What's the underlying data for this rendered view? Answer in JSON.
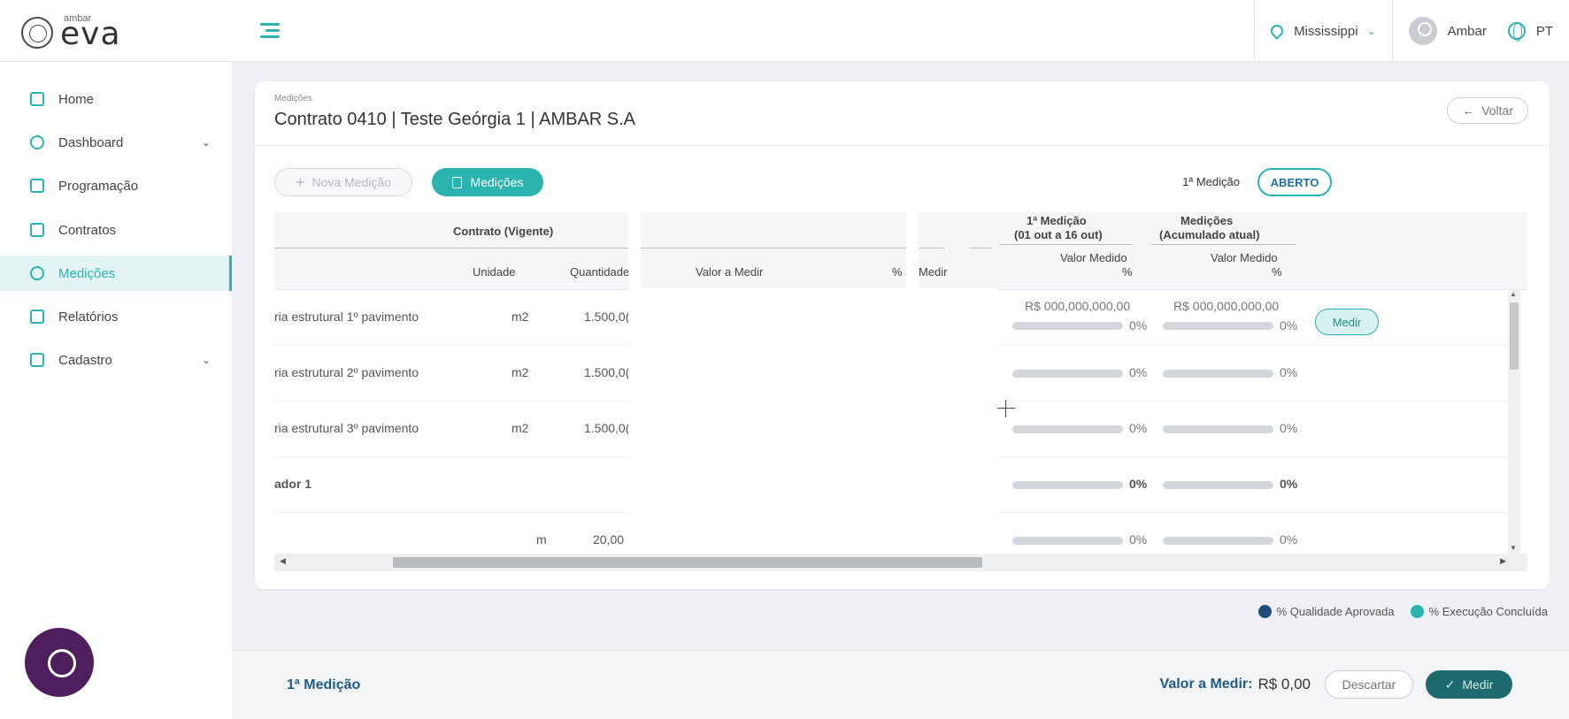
{
  "brand": {
    "small": "ambar",
    "big": "eva"
  },
  "topbar": {
    "location": "Mississippi",
    "user": "Ambar",
    "language": "PT"
  },
  "sidebar": {
    "items": [
      {
        "label": "Home",
        "icon": "home-icon"
      },
      {
        "label": "Dashboard",
        "icon": "dashboard-icon",
        "expandable": true
      },
      {
        "label": "Programação",
        "icon": "calendar-icon"
      },
      {
        "label": "Contratos",
        "icon": "contract-icon"
      },
      {
        "label": "Medições",
        "icon": "money-icon",
        "active": true
      },
      {
        "label": "Relatórios",
        "icon": "report-icon"
      },
      {
        "label": "Cadastro",
        "icon": "edit-icon",
        "expandable": true
      }
    ]
  },
  "page": {
    "breadcrumb": "Medições",
    "title": "Contrato 0410 | Teste Geórgia 1 | AMBAR S.A",
    "back_label": "Voltar",
    "new_button": "Nova Medição",
    "medicoes_button": "Medições",
    "measurement_label": "1ª Medição",
    "status": "ABERTO"
  },
  "table": {
    "group_contrato": "Contrato (Vigente)",
    "group_1a_medicao": "1ª Medição",
    "group_1a_medicao_period": "(01 out a 16 out)",
    "group_medicoes": "Medições",
    "group_medicoes_sub": "(Acumulado atual)",
    "col_unidade": "Unidade",
    "col_quantidade": "Quantidade",
    "col_valor_a_medir": "Valor a Medir",
    "col_pct_cut": "% a",
    "col_medir_cut": "Medir",
    "col_valor_medido": "Valor Medido",
    "col_pct": "%",
    "rows": [
      {
        "desc": "ria estrutural 1º pavimento",
        "unit": "m2",
        "qty": "1.500,0(",
        "val1": "R$ 000,000,000,00",
        "pct1": "0%",
        "val2": "R$ 000,000,000,00",
        "pct2": "0%",
        "action": "Medir"
      },
      {
        "desc": "ria estrutural 2º pavimento",
        "unit": "m2",
        "qty": "1.500,0(",
        "pct1": "0%",
        "pct2": "0%"
      },
      {
        "desc": "ria estrutural 3º pavimento",
        "unit": "m2",
        "qty": "1.500,0(",
        "pct1": "0%",
        "pct2": "0%"
      },
      {
        "desc": "ador 1",
        "pct1": "0%",
        "pct2": "0%",
        "bold": true
      },
      {
        "desc": "",
        "unit": "m",
        "qty": "20,00",
        "pct1": "0%",
        "pct2": "0%"
      }
    ]
  },
  "legend": {
    "quality": "% Qualidade Aprovada",
    "execution": "% Execução Concluída"
  },
  "footer": {
    "title": "1ª Medição",
    "value_label": "Valor a Medir:",
    "value": "R$ 0,00",
    "discard": "Descartar",
    "submit": "Medir"
  },
  "colors": {
    "accent": "#2bb3b0",
    "navy": "#1f4e79",
    "chat": "#4f1f5d"
  }
}
